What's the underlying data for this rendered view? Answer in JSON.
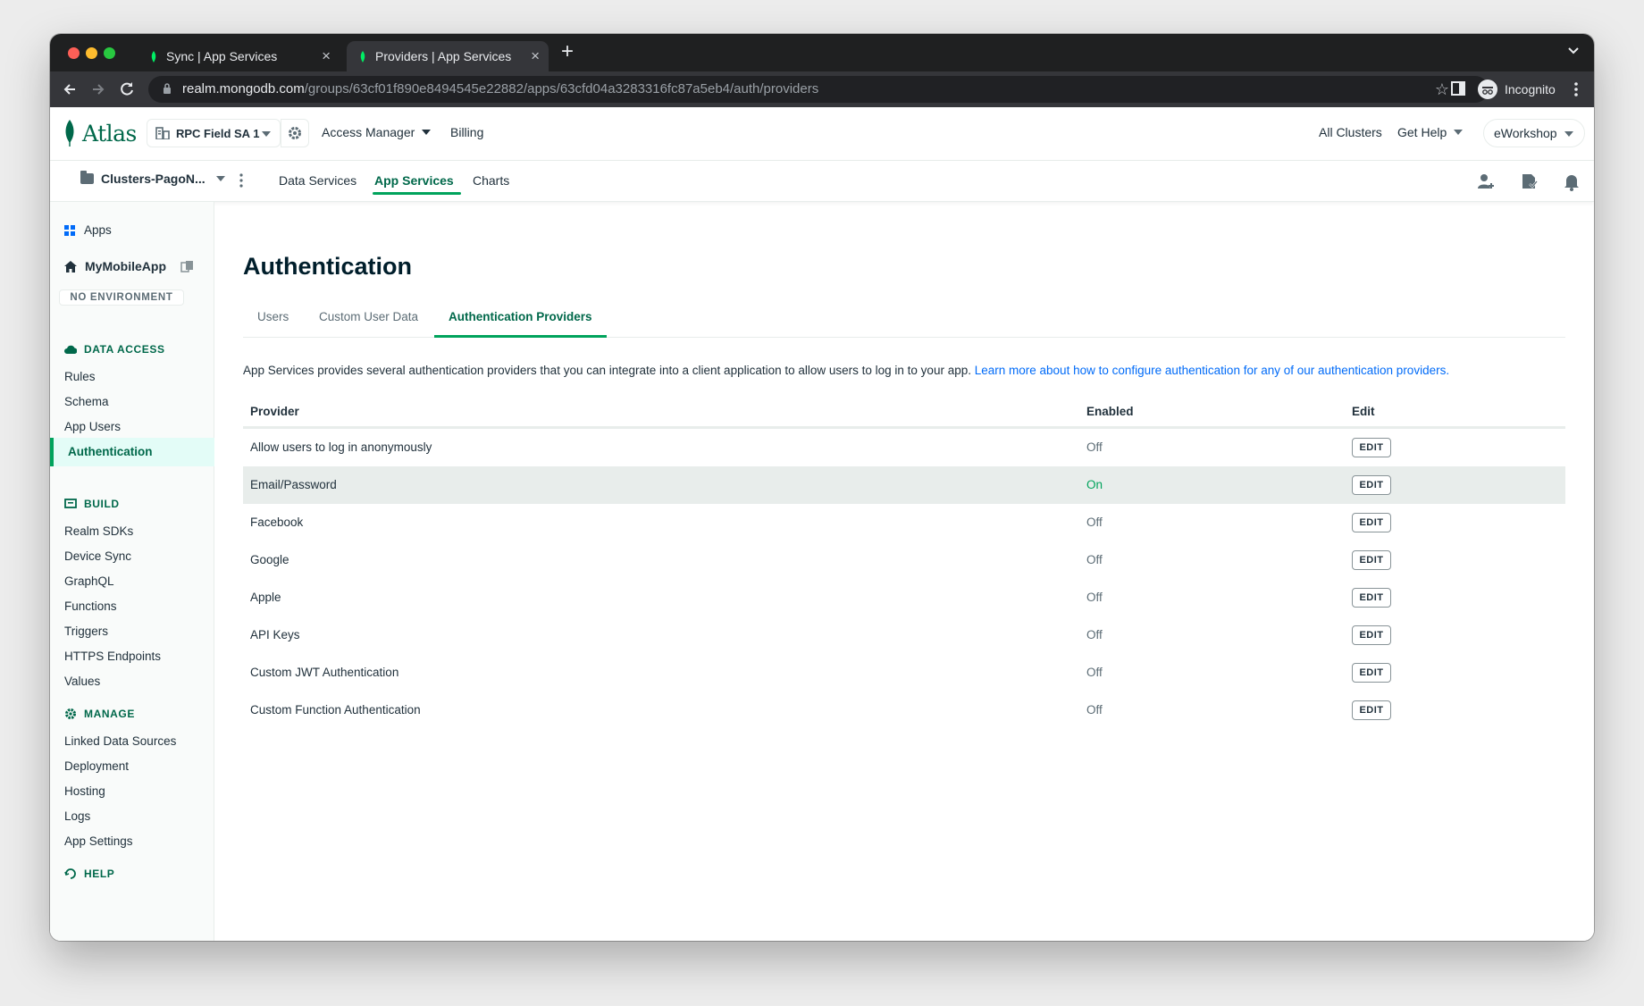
{
  "browser": {
    "tabs": [
      {
        "title": "Sync | App Services",
        "active": false
      },
      {
        "title": "Providers | App Services",
        "active": true
      }
    ],
    "url_host": "realm.mongodb.com",
    "url_path": "/groups/63cf01f890e8494545e22882/apps/63cfd04a3283316fc87a5eb4/auth/providers",
    "profile_label": "Incognito"
  },
  "topnav": {
    "logo": "Atlas",
    "org": "RPC Field SA 1",
    "access_manager": "Access Manager",
    "billing": "Billing",
    "all_clusters": "All Clusters",
    "get_help": "Get Help",
    "org_name": "eWorkshop"
  },
  "projnav": {
    "project": "Clusters-PagoN...",
    "tabs": [
      "Data Services",
      "App Services",
      "Charts"
    ],
    "active_tab": "App Services"
  },
  "sidebar": {
    "apps": "Apps",
    "app_name": "MyMobileApp",
    "environment": "NO ENVIRONMENT",
    "sections": [
      {
        "heading": "DATA ACCESS",
        "items": [
          "Rules",
          "Schema",
          "App Users",
          "Authentication"
        ]
      },
      {
        "heading": "BUILD",
        "items": [
          "Realm SDKs",
          "Device Sync",
          "GraphQL",
          "Functions",
          "Triggers",
          "HTTPS Endpoints",
          "Values"
        ]
      },
      {
        "heading": "MANAGE",
        "items": [
          "Linked Data Sources",
          "Deployment",
          "Hosting",
          "Logs",
          "App Settings"
        ]
      },
      {
        "heading": "HELP",
        "items": []
      }
    ],
    "active_item": "Authentication"
  },
  "main": {
    "title": "Authentication",
    "tabs": [
      "Users",
      "Custom User Data",
      "Authentication Providers"
    ],
    "active_tab": "Authentication Providers",
    "intro_text": "App Services provides several authentication providers that you can integrate into a client application to allow users to log in to your app.",
    "intro_link": "Learn more about how to configure authentication for any of our authentication providers.",
    "table": {
      "headers": [
        "Provider",
        "Enabled",
        "Edit"
      ],
      "edit_label": "EDIT",
      "rows": [
        {
          "provider": "Allow users to log in anonymously",
          "enabled": "Off"
        },
        {
          "provider": "Email/Password",
          "enabled": "On"
        },
        {
          "provider": "Facebook",
          "enabled": "Off"
        },
        {
          "provider": "Google",
          "enabled": "Off"
        },
        {
          "provider": "Apple",
          "enabled": "Off"
        },
        {
          "provider": "API Keys",
          "enabled": "Off"
        },
        {
          "provider": "Custom JWT Authentication",
          "enabled": "Off"
        },
        {
          "provider": "Custom Function Authentication",
          "enabled": "Off"
        }
      ]
    }
  },
  "colors": {
    "brand_green": "#00684a",
    "accent_green": "#00a35c",
    "link_blue": "#016bf8",
    "row_highlight": "#e8edeb"
  }
}
